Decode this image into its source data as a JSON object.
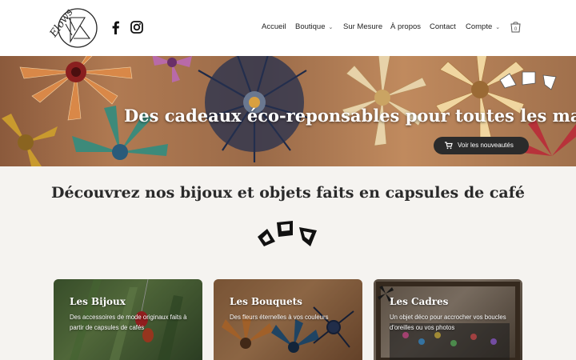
{
  "brand": {
    "logo_text": "Elows"
  },
  "header": {
    "nav": [
      {
        "label": "Accueil",
        "dropdown": false
      },
      {
        "label": "Boutique",
        "dropdown": true
      },
      {
        "label": "Sur Mesure",
        "dropdown": false
      },
      {
        "label": "À propos",
        "dropdown": false
      },
      {
        "label": "Contact",
        "dropdown": false
      },
      {
        "label": "Compte",
        "dropdown": true
      }
    ],
    "cart_count": "0",
    "social_icons": [
      "facebook-icon",
      "instagram-icon"
    ]
  },
  "hero": {
    "title": "Des cadeaux éco-reponsables pour toutes les mamans",
    "button_label": "Voir les nouveautés",
    "button_icon": "cart-icon"
  },
  "intro": {
    "title": "Découvrez nos bijoux et objets faits en capsules de café"
  },
  "categories": [
    {
      "title": "Les Bijoux",
      "description": "Des accessoires de mode originaux faits à partir de capsules de cafés"
    },
    {
      "title": "Les Bouquets",
      "description": "Des fleurs éternelles à vos couleurs"
    },
    {
      "title": "Les Cadres",
      "description": "Un objet déco pour accrocher vos boucles d'oreilles ou vos photos"
    }
  ],
  "colors": {
    "header_bg": "#ffffff",
    "page_bg": "#f5f3f0",
    "button_bg": "#2b2b2b",
    "text_dark": "#2a2a2a"
  }
}
